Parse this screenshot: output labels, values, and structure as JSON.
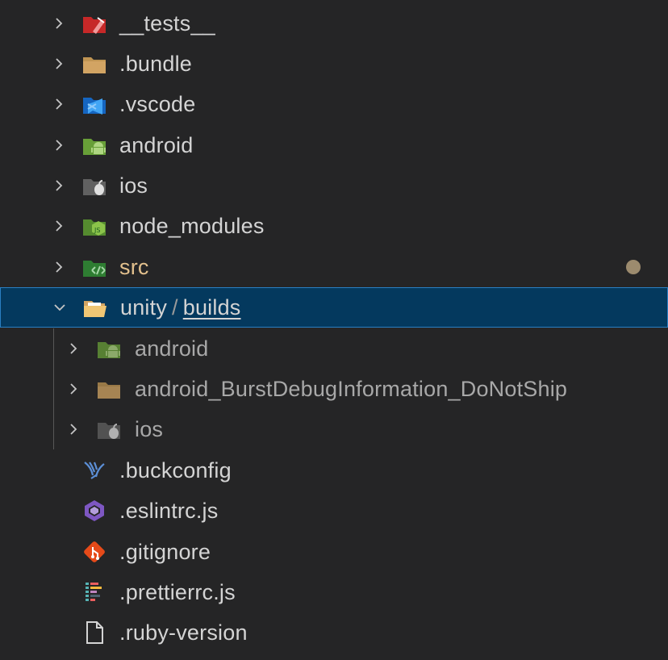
{
  "tree": {
    "items": [
      {
        "label": "__tests__",
        "icon": "tests-folder-icon",
        "expanded": false
      },
      {
        "label": ".bundle",
        "icon": "folder-icon",
        "expanded": false
      },
      {
        "label": ".vscode",
        "icon": "vscode-folder-icon",
        "expanded": false
      },
      {
        "label": "android",
        "icon": "android-folder-icon",
        "expanded": false
      },
      {
        "label": "ios",
        "icon": "apple-folder-icon",
        "expanded": false
      },
      {
        "label": "node_modules",
        "icon": "node-folder-icon",
        "expanded": false
      },
      {
        "label": "src",
        "icon": "src-folder-icon",
        "expanded": false,
        "status": "modified"
      },
      {
        "label": "unity",
        "label_sep": "/",
        "label_child": "builds",
        "icon": "open-folder-icon",
        "expanded": true,
        "selected": true
      },
      {
        "label": "android",
        "icon": "android-folder-icon",
        "expanded": false,
        "depth": 1
      },
      {
        "label": "android_BurstDebugInformation_DoNotShip",
        "icon": "folder-icon",
        "expanded": false,
        "depth": 1
      },
      {
        "label": "ios",
        "icon": "apple-folder-icon",
        "expanded": false,
        "depth": 1
      },
      {
        "label": ".buckconfig",
        "icon": "buck-file-icon"
      },
      {
        "label": ".eslintrc.js",
        "icon": "eslint-file-icon"
      },
      {
        "label": ".gitignore",
        "icon": "git-file-icon"
      },
      {
        "label": ".prettierrc.js",
        "icon": "prettier-file-icon"
      },
      {
        "label": ".ruby-version",
        "icon": "file-icon"
      }
    ]
  },
  "colors": {
    "background": "#252526",
    "selection": "#04395e",
    "selection_border": "#2a7fc2",
    "modified_text": "#e2c08d",
    "modified_dot": "#9c8b6e"
  }
}
